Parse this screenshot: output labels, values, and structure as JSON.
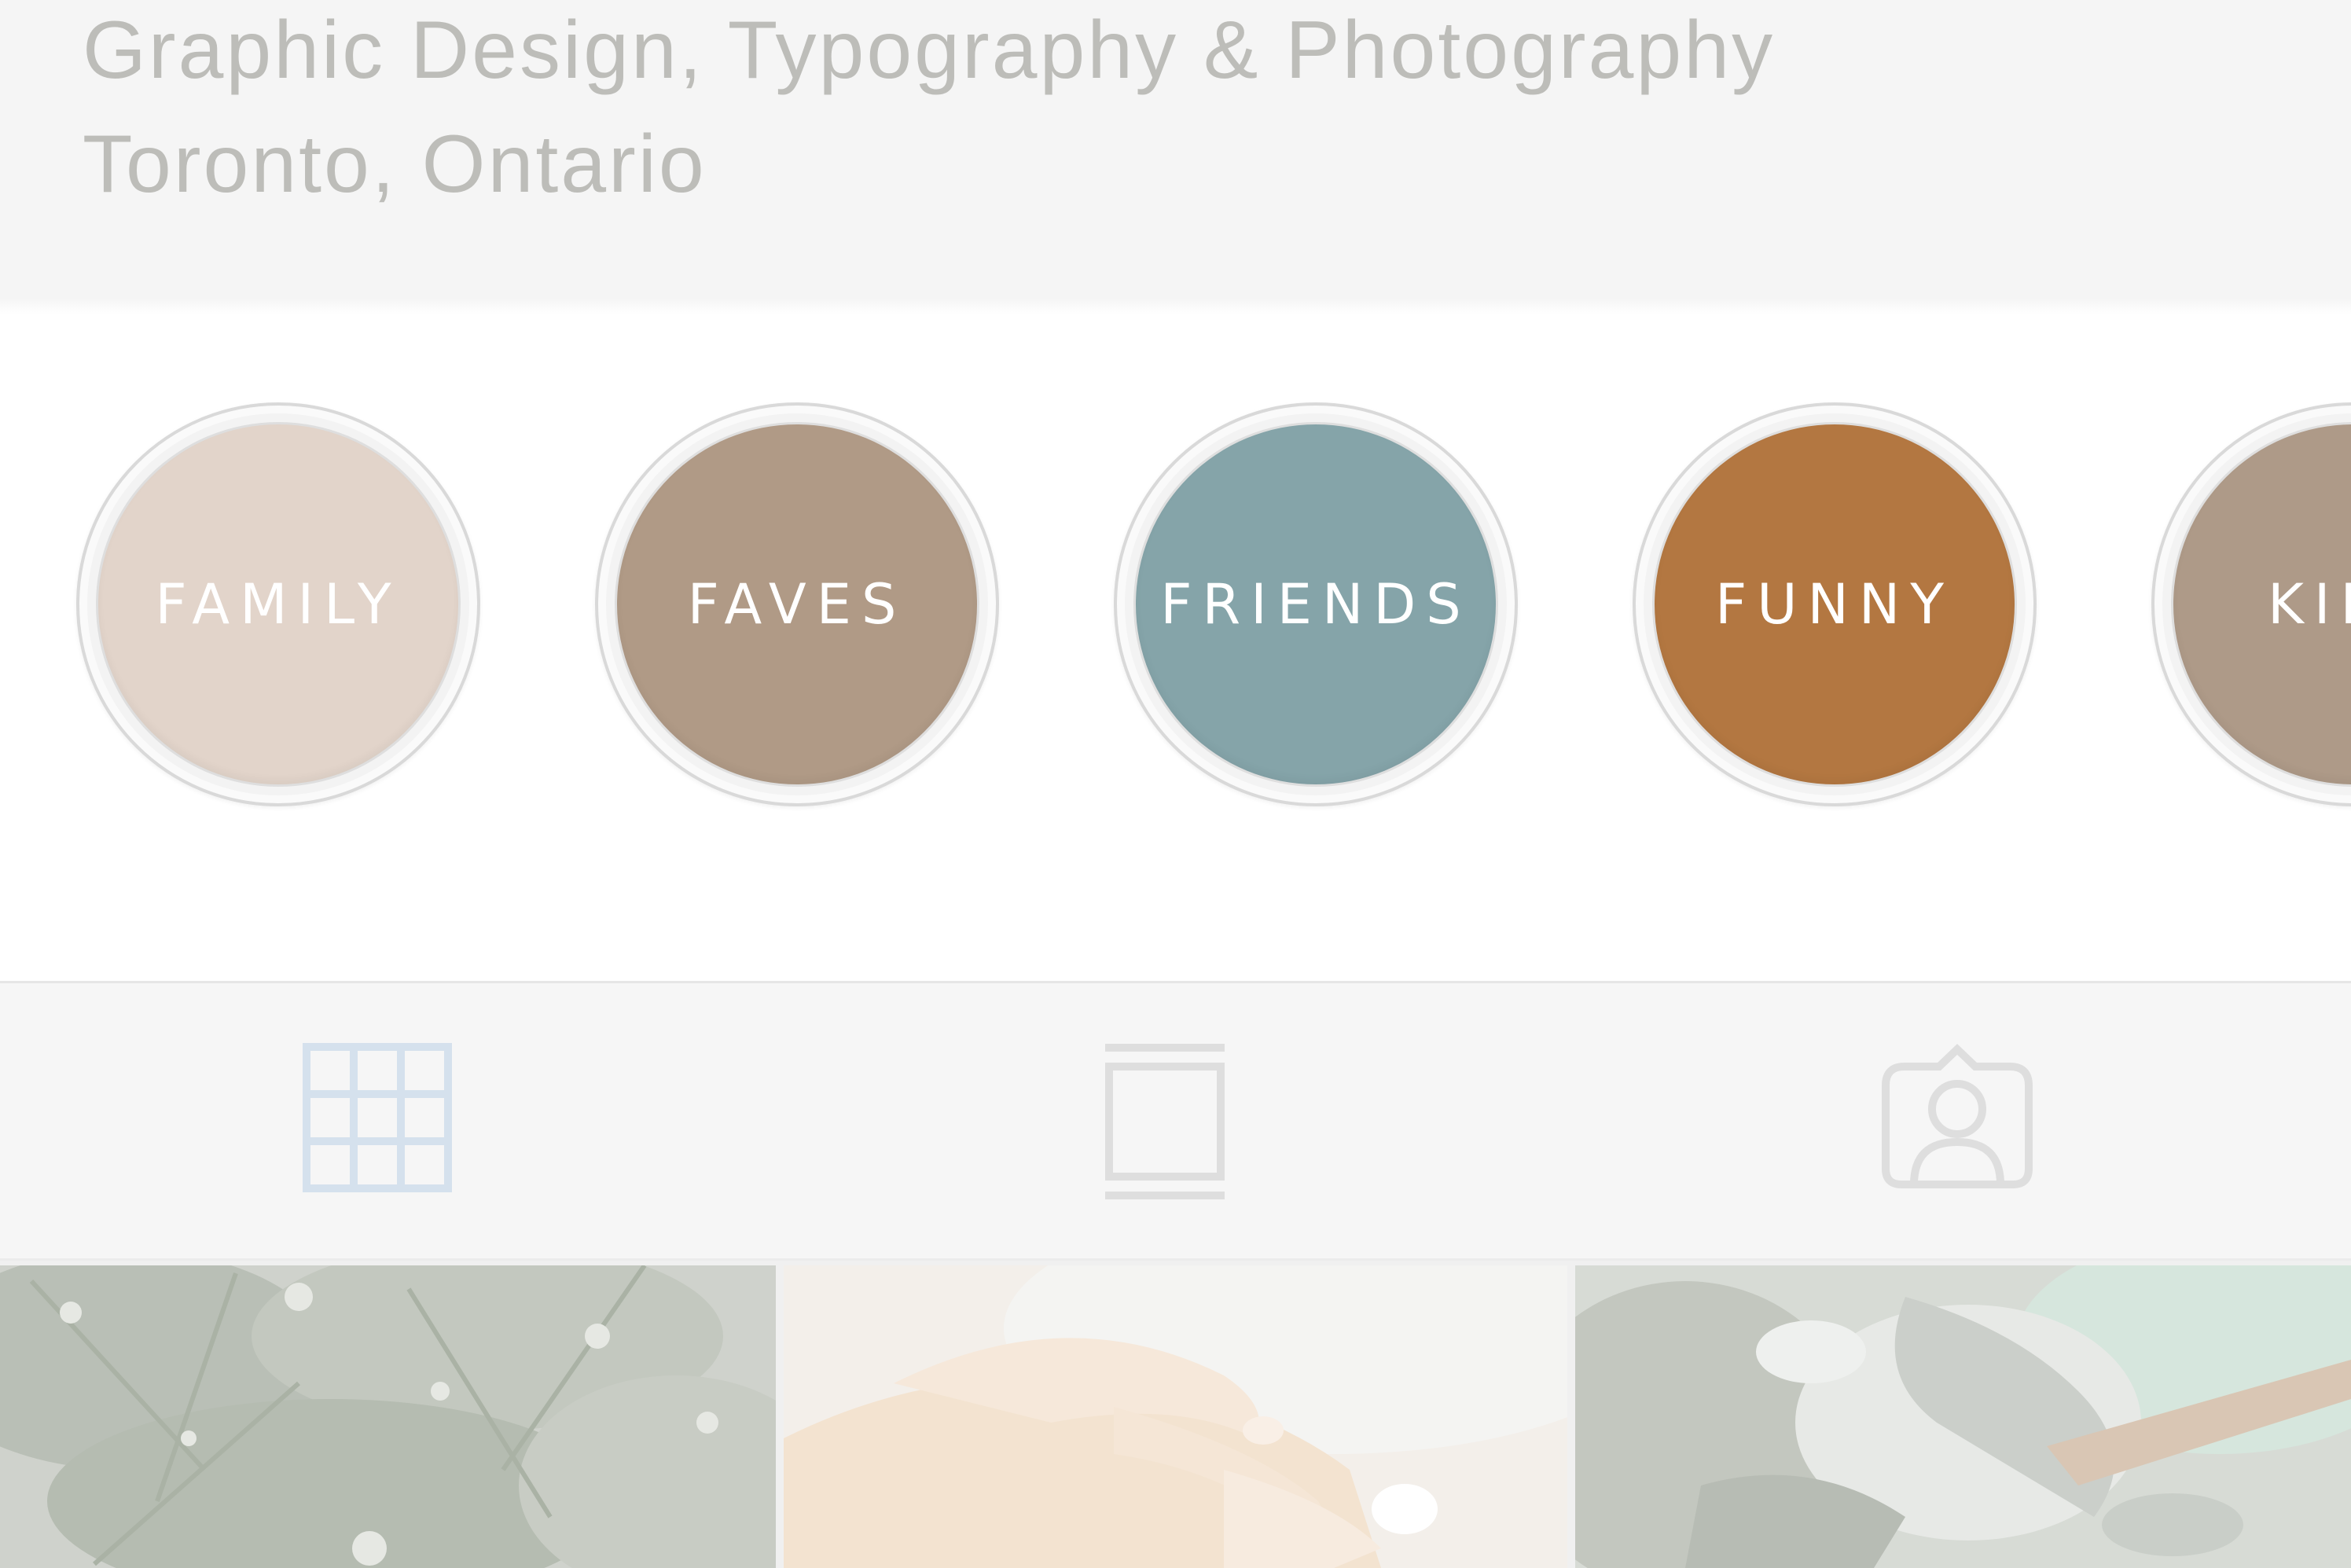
{
  "profile": {
    "bio_line_1": "Graphic Design, Typography & Photography",
    "bio_line_2": "Toronto, Ontario"
  },
  "highlights": [
    {
      "label": "FAMILY",
      "color": "#e2d4ca"
    },
    {
      "label": "FAVES",
      "color": "#b09a86"
    },
    {
      "label": "FRIENDS",
      "color": "#85a4a9"
    },
    {
      "label": "FUNNY",
      "color": "#b37741"
    },
    {
      "label": "KIDS",
      "color": "#ae9a88"
    }
  ],
  "tabs": [
    {
      "icon": "grid-icon",
      "selected": true,
      "color": "#d6e2ee"
    },
    {
      "icon": "feed-icon",
      "selected": false,
      "color": "#dedede"
    },
    {
      "icon": "tagged-icon",
      "selected": false,
      "color": "#dedede"
    }
  ],
  "photos": [
    {
      "subject": "foliage-photo"
    },
    {
      "subject": "hands-photo"
    },
    {
      "subject": "stream-photo"
    }
  ]
}
